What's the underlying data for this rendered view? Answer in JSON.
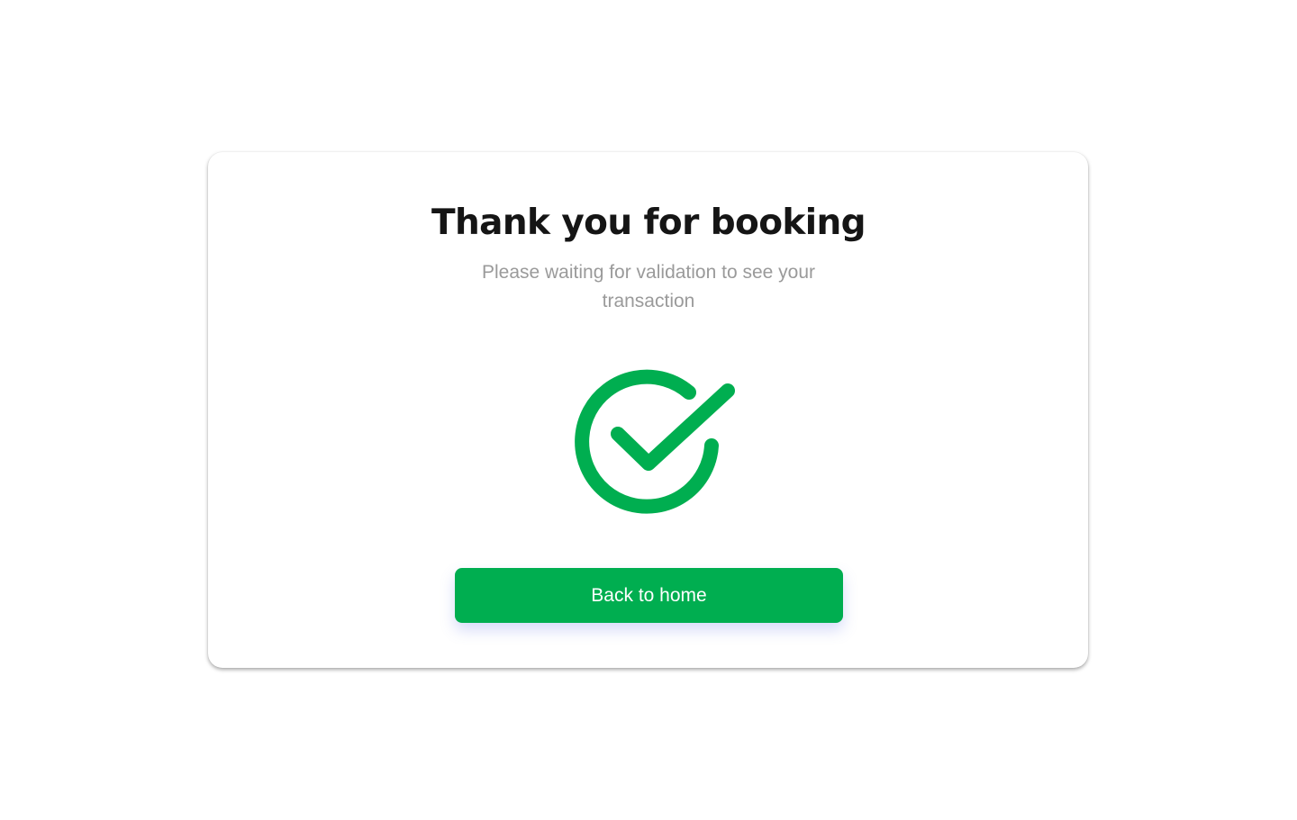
{
  "confirmation": {
    "title": "Thank you for booking",
    "subtitle": "Please waiting for validation to see your transaction",
    "icon": "check-circle-icon",
    "button_label": "Back to home"
  },
  "colors": {
    "accent": "#00ae50",
    "title": "#151515",
    "subtitle": "#9a9a9a",
    "background": "#ffffff"
  }
}
